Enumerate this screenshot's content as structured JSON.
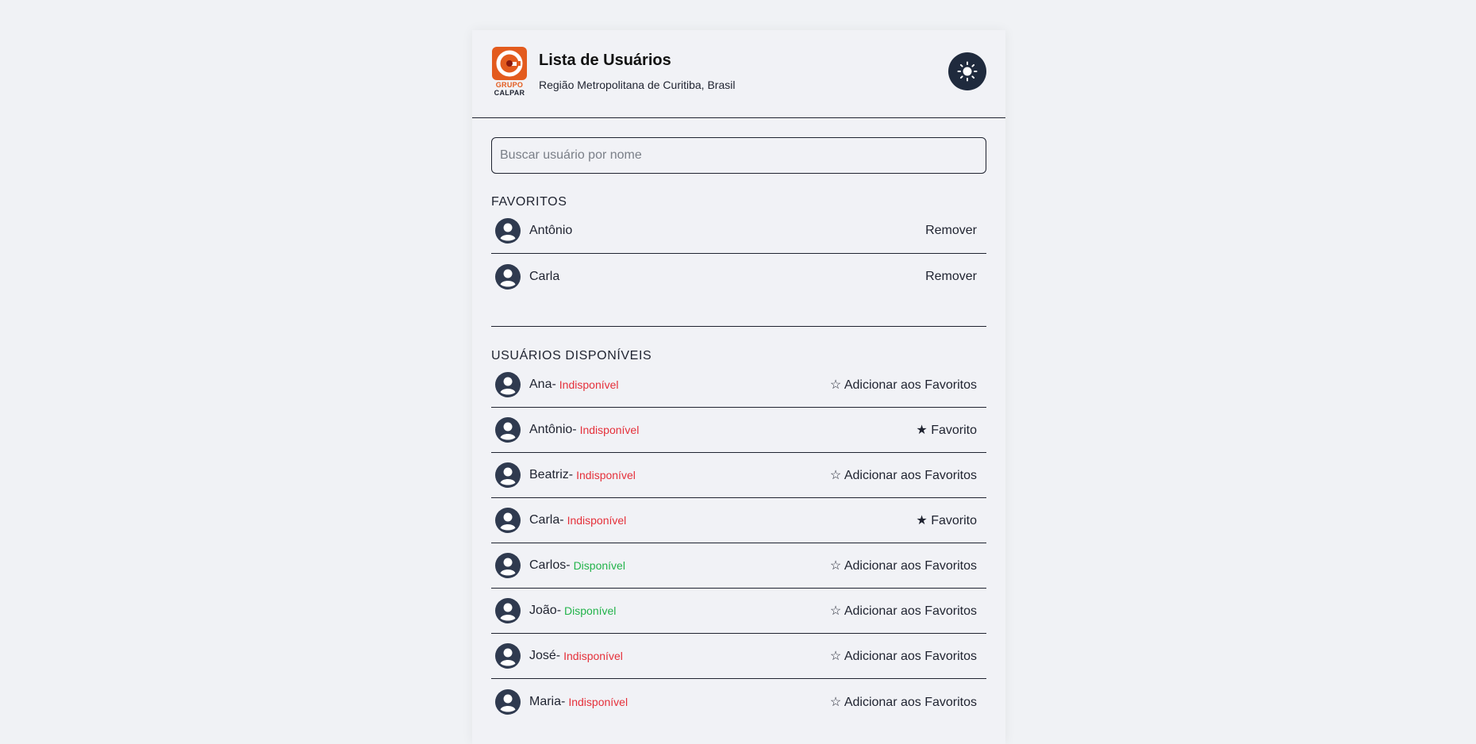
{
  "header": {
    "title": "Lista de Usuários",
    "subtitle": "Região Metropolitana de Curitiba, Brasil",
    "logo_line1": "GRUPO",
    "logo_line2": "CALPAR",
    "theme_icon": "sun-icon"
  },
  "search": {
    "placeholder": "Buscar usuário por nome",
    "value": ""
  },
  "favorites": {
    "title": "FAVORITOS",
    "items": [
      {
        "name": "Antônio",
        "action": "Remover"
      },
      {
        "name": "Carla",
        "action": "Remover"
      }
    ]
  },
  "available": {
    "title": "USUÁRIOS DISPONÍVEIS",
    "items": [
      {
        "name": "Ana",
        "sep": " -",
        "status": "Indisponível",
        "action": "☆ Adicionar aos Favoritos"
      },
      {
        "name": "Antônio",
        "sep": " -",
        "status": "Indisponível",
        "action": "★ Favorito"
      },
      {
        "name": "Beatriz",
        "sep": " -",
        "status": "Indisponível",
        "action": "☆ Adicionar aos Favoritos"
      },
      {
        "name": "Carla",
        "sep": " -",
        "status": "Indisponível",
        "action": "★ Favorito"
      },
      {
        "name": "Carlos",
        "sep": " -",
        "status": "Disponível",
        "action": "☆ Adicionar aos Favoritos"
      },
      {
        "name": "João",
        "sep": " -",
        "status": "Disponível",
        "action": "☆ Adicionar aos Favoritos"
      },
      {
        "name": "José",
        "sep": " -",
        "status": "Indisponível",
        "action": "☆ Adicionar aos Favoritos"
      },
      {
        "name": "Maria",
        "sep": " -",
        "status": "Indisponível",
        "action": "☆ Adicionar aos Favoritos"
      }
    ]
  },
  "colors": {
    "unavailable": "#e5303a",
    "available": "#22b34a",
    "brand": "#e35b1e",
    "dark": "#1f2a3d"
  }
}
